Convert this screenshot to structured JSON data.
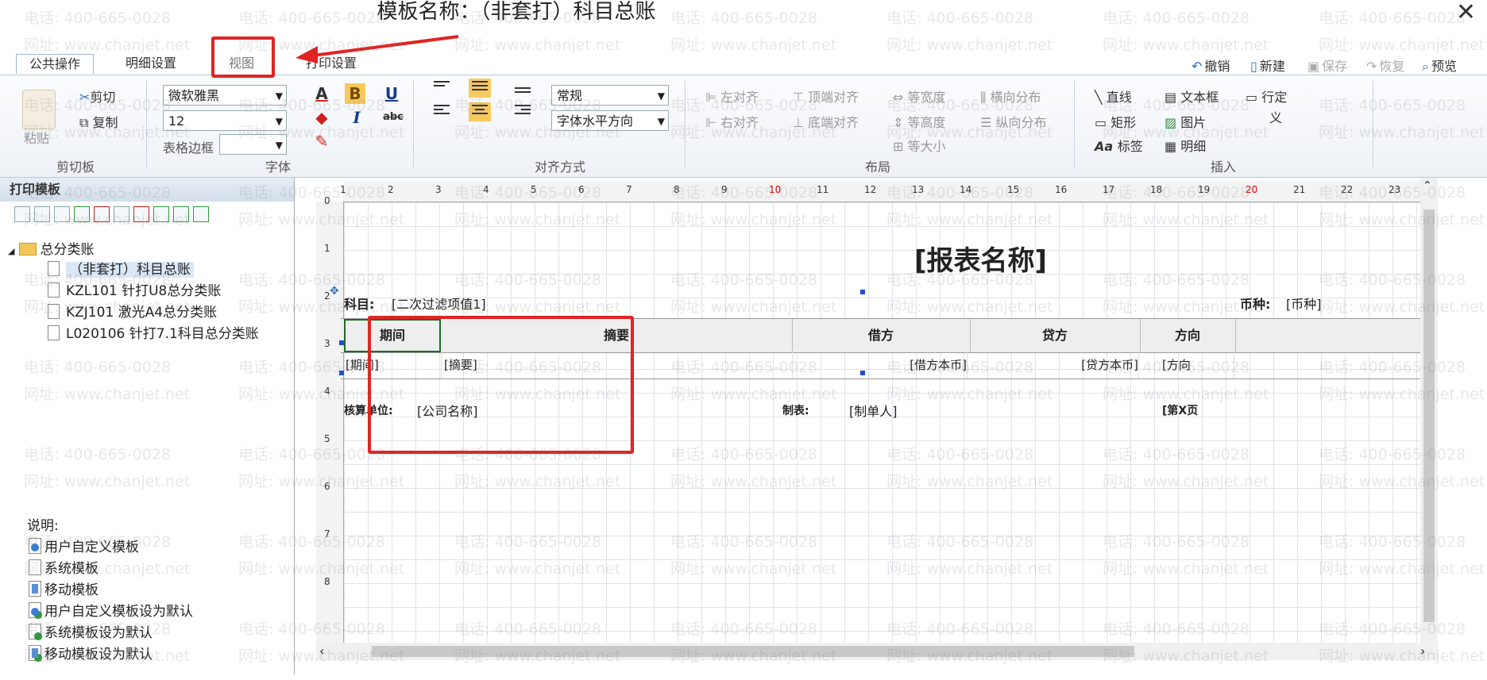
{
  "window": {
    "title": "模板名称：（非套打）科目总账",
    "close": "✕"
  },
  "tabs": [
    "公共操作",
    "明细设置",
    "视图",
    "打印设置"
  ],
  "tab_controls": {
    "undo": "撤销",
    "new": "新建",
    "save": "保存",
    "restore": "恢复",
    "preview": "预览"
  },
  "clipboard": {
    "paste": "粘贴",
    "cut": "剪切",
    "copy": "复制",
    "label": "剪切板"
  },
  "font": {
    "family": "微软雅黑",
    "size": "12",
    "border_label": "表格边框",
    "border_value": "",
    "label": "字体",
    "bold": "B",
    "italic": "I",
    "underline": "U",
    "strike": "abc",
    "font_color": "A"
  },
  "align": {
    "style": "常规",
    "direction": "字体水平方向",
    "label": "对齐方式"
  },
  "layout": {
    "items": [
      "左对齐",
      "右对齐",
      "顶端对齐",
      "底端对齐",
      "等宽度",
      "等高度",
      "等大小",
      "横向分布",
      "纵向分布"
    ],
    "label": "布局"
  },
  "insert": {
    "line": "直线",
    "rect": "矩形",
    "label_item": "标签",
    "textbox": "文本框",
    "image": "图片",
    "detail": "明细",
    "fixed_line_a": "行定",
    "fixed_line_b": "义",
    "label": "插入"
  },
  "left_panel": {
    "title": "打印模板",
    "tree": {
      "root": "总分类账",
      "items": [
        "（非套打）科目总账",
        "KZL101 针打U8总分类账",
        "KZJ101 激光A4总分类账",
        "L020106 针打7.1科目总分类账"
      ]
    },
    "legend_title": "说明:",
    "legend": [
      "用户自定义模板",
      "系统模板",
      "移动模板",
      "用户自定义模板设为默认",
      "系统模板设为默认",
      "移动模板设为默认"
    ]
  },
  "ruler": {
    "top": [
      "1",
      "2",
      "3",
      "4",
      "5",
      "6",
      "7",
      "8",
      "9",
      "10",
      "11",
      "12",
      "13",
      "14",
      "15",
      "16",
      "17",
      "18",
      "19",
      "20",
      "21",
      "22",
      "23"
    ],
    "left": [
      "0",
      "1",
      "2",
      "3",
      "4",
      "5",
      "6",
      "7",
      "8"
    ]
  },
  "report": {
    "title": "[报表名称]",
    "subject_label": "科目:",
    "subject_value": "[二次过滤项值1]",
    "currency_label": "币种:",
    "currency_value": "[币种]",
    "headers": [
      "期间",
      "摘要",
      "借方",
      "贷方",
      "方向"
    ],
    "row": [
      "[期间]",
      "[摘要]",
      "[借方本币]",
      "[贷方本币]",
      "[方向"
    ],
    "footer": {
      "unit_label": "核算单位:",
      "unit_value": "[公司名称]",
      "maker_label": "制表:",
      "maker_value": "[制单人]",
      "page": "[第X页"
    }
  },
  "watermark": {
    "phone": "电话: 400-665-0028",
    "site": "网址: www.chanjet.net"
  },
  "colors": {
    "highlight": "#e02424",
    "selection": "#f7c95d",
    "handle": "#1f4fd6"
  }
}
